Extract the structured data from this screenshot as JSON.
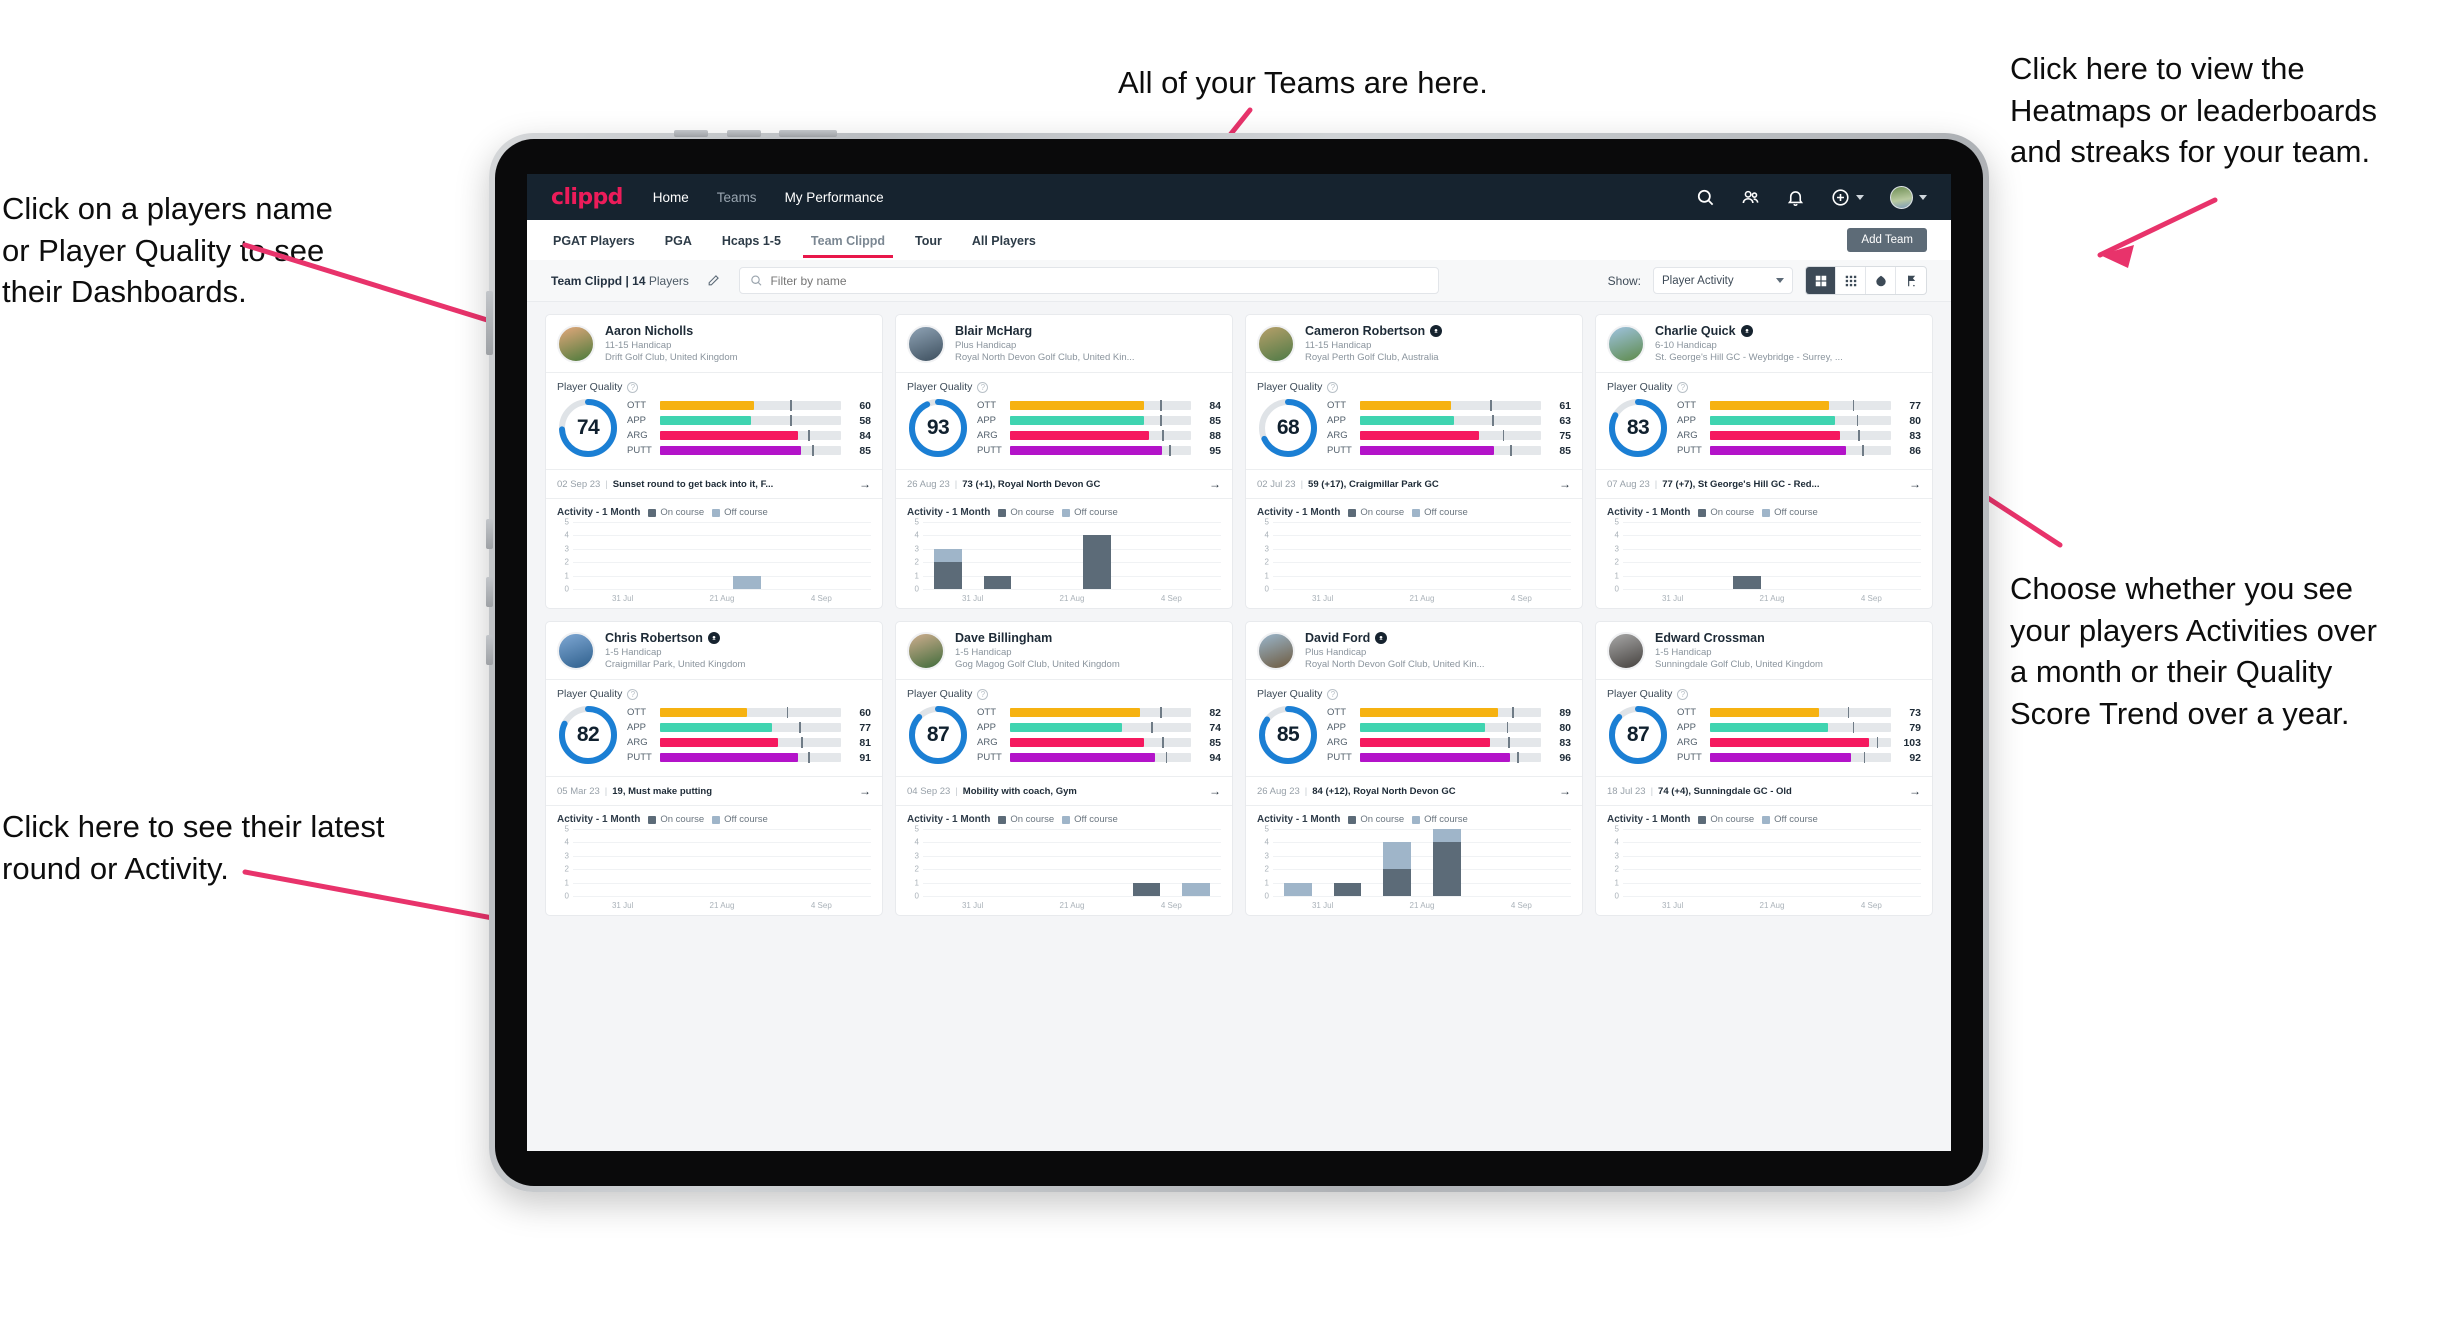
{
  "annotations": [
    {
      "id": "left-top",
      "text": "Click on a players name\nor Player Quality to see\ntheir Dashboards."
    },
    {
      "id": "top-center",
      "text": "All of your Teams are here."
    },
    {
      "id": "right-top",
      "text": "Click here to view the\nHeatmaps or leaderboards\nand streaks for your team."
    },
    {
      "id": "right-mid",
      "text": "Choose whether you see\nyour players Activities over\na month or their Quality\nScore Trend over a year."
    },
    {
      "id": "left-bottom",
      "text": "Click here to see their latest\nround or Activity."
    }
  ],
  "topnav": {
    "brand": "clippd",
    "links": [
      {
        "label": "Home",
        "active": true
      },
      {
        "label": "Teams",
        "active": false
      },
      {
        "label": "My Performance",
        "active": true
      }
    ],
    "icons": [
      "search-icon",
      "people-icon",
      "bell-icon",
      "plus-circle-icon",
      "avatar"
    ]
  },
  "tabs": {
    "items": [
      {
        "label": "PGAT Players",
        "active": false
      },
      {
        "label": "PGA",
        "active": false
      },
      {
        "label": "Hcaps 1-5",
        "active": false
      },
      {
        "label": "Team Clippd",
        "active": true
      },
      {
        "label": "Tour",
        "active": false
      },
      {
        "label": "All Players",
        "active": false
      }
    ],
    "add_team_label": "Add Team"
  },
  "filterbar": {
    "team_label": "Team Clippd | 14",
    "team_label_suffix": "Players",
    "search_placeholder": "Filter by name",
    "show_label": "Show:",
    "show_value": "Player Activity",
    "view_buttons": [
      "grid-large-icon",
      "grid-small-icon",
      "heatmap-icon",
      "flag-icon"
    ],
    "active_view": 0
  },
  "colors": {
    "ott": "#f6b211",
    "app": "#3fd4b0",
    "arg": "#f5195f",
    "putt": "#b313c9",
    "ring": "#1b7fd4",
    "ring_track": "#dfe3e7",
    "on_course": "#5c6b78",
    "off_course": "#9fb5c9",
    "accent": "#e8174a",
    "navy": "#16232f"
  },
  "chart_data": {
    "type": "bar",
    "title": "Activity - 1 Month",
    "legend": [
      "On course",
      "Off course"
    ],
    "ylim": [
      0,
      5
    ],
    "yticks": [
      0,
      1,
      2,
      3,
      4,
      5
    ],
    "xlabels": [
      "31 Jul",
      "21 Aug",
      "4 Sep"
    ],
    "bins": 6,
    "grid": true,
    "legend_position": "top"
  },
  "players": [
    {
      "name": "Aaron Nicholls",
      "verified": false,
      "handicap": "11-15 Handicap",
      "club": "Drift Golf Club, United Kingdom",
      "avatar_from": "#e3a87c",
      "avatar_to": "#4a7a3a",
      "quality_label": "Player Quality",
      "quality": 74,
      "metrics": [
        {
          "key": "OTT",
          "value": 60,
          "fill": 52,
          "tick": 72
        },
        {
          "key": "APP",
          "value": 58,
          "fill": 50,
          "tick": 72
        },
        {
          "key": "ARG",
          "value": 84,
          "fill": 76,
          "tick": 82
        },
        {
          "key": "PUTT",
          "value": 85,
          "fill": 78,
          "tick": 84
        }
      ],
      "round_date": "02 Sep 23",
      "round_text": "Sunset round to get back into it, F...",
      "activity": {
        "on": [
          0,
          0,
          0,
          0,
          0,
          0
        ],
        "off": [
          0,
          0,
          0,
          1,
          0,
          0
        ]
      }
    },
    {
      "name": "Blair McHarg",
      "verified": false,
      "handicap": "Plus Handicap",
      "club": "Royal North Devon Golf Club, United Kin...",
      "avatar_from": "#8fa3b5",
      "avatar_to": "#3d4f5e",
      "quality_label": "Player Quality",
      "quality": 93,
      "metrics": [
        {
          "key": "OTT",
          "value": 84,
          "fill": 74,
          "tick": 83
        },
        {
          "key": "APP",
          "value": 85,
          "fill": 74,
          "tick": 83
        },
        {
          "key": "ARG",
          "value": 88,
          "fill": 77,
          "tick": 84
        },
        {
          "key": "PUTT",
          "value": 95,
          "fill": 84,
          "tick": 88
        }
      ],
      "round_date": "26 Aug 23",
      "round_text": "73 (+1), Royal North Devon GC",
      "activity": {
        "on": [
          2,
          1,
          0,
          4,
          0,
          0
        ],
        "off": [
          1,
          0,
          0,
          0,
          0,
          0
        ]
      }
    },
    {
      "name": "Cameron Robertson",
      "verified": true,
      "handicap": "11-15 Handicap",
      "club": "Royal Perth Golf Club, Australia",
      "avatar_from": "#b7a06a",
      "avatar_to": "#4e7a46",
      "quality_label": "Player Quality",
      "quality": 68,
      "metrics": [
        {
          "key": "OTT",
          "value": 61,
          "fill": 50,
          "tick": 72
        },
        {
          "key": "APP",
          "value": 63,
          "fill": 52,
          "tick": 73
        },
        {
          "key": "ARG",
          "value": 75,
          "fill": 66,
          "tick": 79
        },
        {
          "key": "PUTT",
          "value": 85,
          "fill": 74,
          "tick": 83
        }
      ],
      "round_date": "02 Jul 23",
      "round_text": "59 (+17), Craigmillar Park GC",
      "activity": {
        "on": [
          0,
          0,
          0,
          0,
          0,
          0
        ],
        "off": [
          0,
          0,
          0,
          0,
          0,
          0
        ]
      }
    },
    {
      "name": "Charlie Quick",
      "verified": true,
      "handicap": "6-10 Handicap",
      "club": "St. George's Hill GC - Weybridge - Surrey, ...",
      "avatar_from": "#9fc3e0",
      "avatar_to": "#5d8a4a",
      "quality_label": "Player Quality",
      "quality": 83,
      "metrics": [
        {
          "key": "OTT",
          "value": 77,
          "fill": 66,
          "tick": 79
        },
        {
          "key": "APP",
          "value": 80,
          "fill": 69,
          "tick": 81
        },
        {
          "key": "ARG",
          "value": 83,
          "fill": 72,
          "tick": 82
        },
        {
          "key": "PUTT",
          "value": 86,
          "fill": 75,
          "tick": 84
        }
      ],
      "round_date": "07 Aug 23",
      "round_text": "77 (+7), St George's Hill GC - Red...",
      "activity": {
        "on": [
          0,
          0,
          1,
          0,
          0,
          0
        ],
        "off": [
          0,
          0,
          0,
          0,
          0,
          0
        ]
      }
    },
    {
      "name": "Chris Robertson",
      "verified": true,
      "handicap": "1-5 Handicap",
      "club": "Craigmillar Park, United Kingdom",
      "avatar_from": "#7fa8d4",
      "avatar_to": "#2e5f8c",
      "quality_label": "Player Quality",
      "quality": 82,
      "metrics": [
        {
          "key": "OTT",
          "value": 60,
          "fill": 48,
          "tick": 70
        },
        {
          "key": "APP",
          "value": 77,
          "fill": 62,
          "tick": 77
        },
        {
          "key": "ARG",
          "value": 81,
          "fill": 65,
          "tick": 78
        },
        {
          "key": "PUTT",
          "value": 91,
          "fill": 76,
          "tick": 82
        }
      ],
      "round_date": "05 Mar 23",
      "round_text": "19, Must make putting",
      "activity": {
        "on": [
          0,
          0,
          0,
          0,
          0,
          0
        ],
        "off": [
          0,
          0,
          0,
          0,
          0,
          0
        ]
      }
    },
    {
      "name": "Dave Billingham",
      "verified": false,
      "handicap": "1-5 Handicap",
      "club": "Gog Magog Golf Club, United Kingdom",
      "avatar_from": "#cfae8f",
      "avatar_to": "#3f6b3a",
      "quality_label": "Player Quality",
      "quality": 87,
      "metrics": [
        {
          "key": "OTT",
          "value": 82,
          "fill": 72,
          "tick": 83
        },
        {
          "key": "APP",
          "value": 74,
          "fill": 62,
          "tick": 78
        },
        {
          "key": "ARG",
          "value": 85,
          "fill": 74,
          "tick": 84
        },
        {
          "key": "PUTT",
          "value": 94,
          "fill": 80,
          "tick": 86
        }
      ],
      "round_date": "04 Sep 23",
      "round_text": "Mobility with coach, Gym",
      "activity": {
        "on": [
          0,
          0,
          0,
          0,
          1,
          0
        ],
        "off": [
          0,
          0,
          0,
          0,
          0,
          1
        ]
      }
    },
    {
      "name": "David Ford",
      "verified": true,
      "handicap": "Plus Handicap",
      "club": "Royal North Devon Golf Club, United Kin...",
      "avatar_from": "#9ab6cc",
      "avatar_to": "#6e5a3e",
      "quality_label": "Player Quality",
      "quality": 85,
      "metrics": [
        {
          "key": "OTT",
          "value": 89,
          "fill": 76,
          "tick": 84
        },
        {
          "key": "APP",
          "value": 80,
          "fill": 69,
          "tick": 81
        },
        {
          "key": "ARG",
          "value": 83,
          "fill": 72,
          "tick": 82
        },
        {
          "key": "PUTT",
          "value": 96,
          "fill": 83,
          "tick": 87
        }
      ],
      "round_date": "26 Aug 23",
      "round_text": "84 (+12), Royal North Devon GC",
      "activity": {
        "on": [
          0,
          1,
          2,
          4,
          0,
          0
        ],
        "off": [
          1,
          0,
          2,
          1,
          0,
          0
        ]
      }
    },
    {
      "name": "Edward Crossman",
      "verified": false,
      "handicap": "1-5 Handicap",
      "club": "Sunningdale Golf Club, United Kingdom",
      "avatar_from": "#a8a8a8",
      "avatar_to": "#45413e",
      "quality_label": "Player Quality",
      "quality": 87,
      "metrics": [
        {
          "key": "OTT",
          "value": 73,
          "fill": 60,
          "tick": 76
        },
        {
          "key": "APP",
          "value": 79,
          "fill": 65,
          "tick": 79
        },
        {
          "key": "ARG",
          "value": 103,
          "fill": 88,
          "tick": 92
        },
        {
          "key": "PUTT",
          "value": 92,
          "fill": 78,
          "tick": 85
        }
      ],
      "round_date": "18 Jul 23",
      "round_text": "74 (+4), Sunningdale GC - Old",
      "activity": {
        "on": [
          0,
          0,
          0,
          0,
          0,
          0
        ],
        "off": [
          0,
          0,
          0,
          0,
          0,
          0
        ]
      }
    }
  ]
}
